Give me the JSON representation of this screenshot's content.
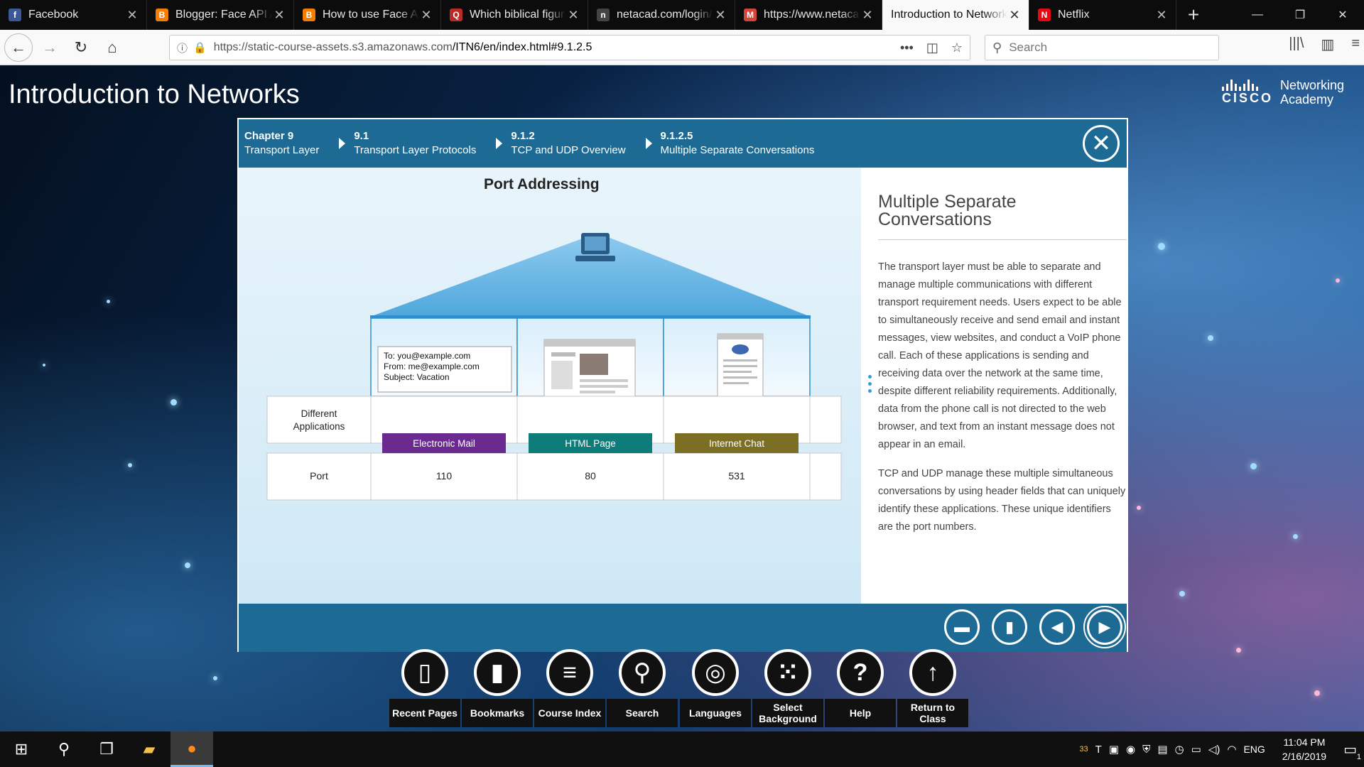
{
  "tabs": [
    {
      "title": "Facebook",
      "favicon": "facebook-icon",
      "color": "#3b5998",
      "glyph": "f"
    },
    {
      "title": "Blogger: Face API A",
      "favicon": "blogger-icon",
      "color": "#f57d00",
      "glyph": "B"
    },
    {
      "title": "How to use Face AP",
      "favicon": "blogger-icon",
      "color": "#f57d00",
      "glyph": "B"
    },
    {
      "title": "Which biblical figur",
      "favicon": "quora-icon",
      "color": "#b92b27",
      "glyph": "Q"
    },
    {
      "title": "netacad.com/login/",
      "favicon": "netacad-icon",
      "color": "#444",
      "glyph": "n"
    },
    {
      "title": "https://www.netacad",
      "favicon": "gmail-icon",
      "color": "#d44638",
      "glyph": "M"
    },
    {
      "title": "Introduction to Network",
      "favicon": "none",
      "color": "",
      "glyph": ""
    },
    {
      "title": "Netflix",
      "favicon": "netflix-icon",
      "color": "#e50914",
      "glyph": "N"
    }
  ],
  "address": {
    "url_prefix": "https://static-course-assets.s3.amazonaws.com",
    "url_path": "/ITN6/en/index.html#9.1.2.5",
    "search_placeholder": "Search"
  },
  "app": {
    "title": "Introduction to Networks",
    "brand_word": "CISCO",
    "brand_sub1": "Networking",
    "brand_sub2": "Academy"
  },
  "breadcrumb": [
    {
      "num": "Chapter 9",
      "label": "Transport Layer"
    },
    {
      "num": "9.1",
      "label": "Transport Layer Protocols"
    },
    {
      "num": "9.1.2",
      "label": "TCP and UDP Overview"
    },
    {
      "num": "9.1.2.5",
      "label": "Multiple Separate Conversations"
    }
  ],
  "diagram": {
    "title": "Port Addressing",
    "email_lines": [
      "To: you@example.com",
      "From: me@example.com",
      "Subject: Vacation"
    ],
    "row1_label": "Different Applications",
    "row2_label": "Port",
    "apps": [
      {
        "name": "Electronic Mail",
        "color": "#6a2a8f",
        "port": "110"
      },
      {
        "name": "HTML Page",
        "color": "#0e7c78",
        "port": "80"
      },
      {
        "name": "Internet Chat",
        "color": "#7c6f23",
        "port": "531"
      }
    ]
  },
  "panel": {
    "title": "Multiple Separate Conversations",
    "paragraphs": [
      "The transport layer must be able to separate and manage multiple communications with different transport requirement needs. Users expect to be able to simultaneously receive and send email and instant messages, view websites, and conduct a VoIP phone call. Each of these applications is sending and receiving data over the network at the same time, despite different reliability requirements. Additionally, data from the phone call is not directed to the web browser, and text from an instant message does not appear in an email.",
      "TCP and UDP manage these multiple simultaneous conversations by using header fields that can uniquely identify these applications. These unique identifiers are the port numbers."
    ]
  },
  "toolbar": [
    {
      "label": "Recent Pages",
      "icon": "recent-pages-icon",
      "glyph": "▯"
    },
    {
      "label": "Bookmarks",
      "icon": "bookmark-icon",
      "glyph": "▮"
    },
    {
      "label": "Course Index",
      "icon": "menu-icon",
      "glyph": "≡"
    },
    {
      "label": "Search",
      "icon": "search-icon",
      "glyph": "⚲"
    },
    {
      "label": "Languages",
      "icon": "globe-icon",
      "glyph": "◎"
    },
    {
      "label": "Select Background",
      "icon": "grid-icon",
      "glyph": "⁙"
    },
    {
      "label": "Help",
      "icon": "help-icon",
      "glyph": "?"
    },
    {
      "label": "Return to Class",
      "icon": "arrow-up-icon",
      "glyph": "↑"
    }
  ],
  "system": {
    "notif_count": "33",
    "lang": "ENG",
    "time": "11:04 PM",
    "date": "2/16/2019",
    "action_count": "1"
  }
}
